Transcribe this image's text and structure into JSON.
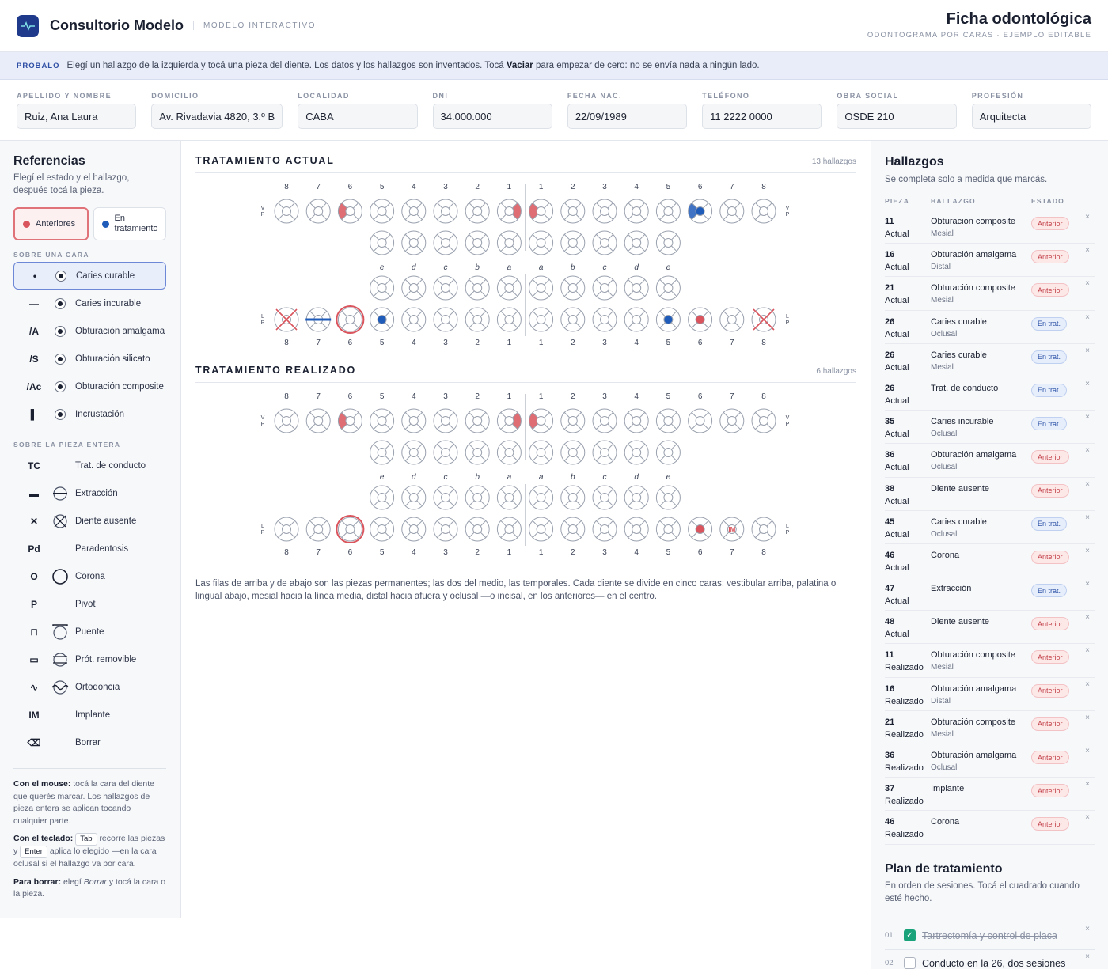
{
  "header": {
    "app_title": "Consultorio Modelo",
    "app_subtitle": "MODELO INTERACTIVO",
    "doc_title": "Ficha odontológica",
    "doc_subtitle": "ODONTOGRAMA POR CARAS · EJEMPLO EDITABLE"
  },
  "banner": {
    "tag": "PROBALO",
    "text_before": "Elegí un hallazgo de la izquierda y tocá una pieza del diente. Los datos y los hallazgos son inventados. Tocá",
    "bold": "Vaciar",
    "text_after": "para empezar de cero: no se envía nada a ningún lado."
  },
  "patient": [
    {
      "label": "APELLIDO Y NOMBRE",
      "value": "Ruiz, Ana Laura"
    },
    {
      "label": "DOMICILIO",
      "value": "Av. Rivadavia 4820, 3.º B"
    },
    {
      "label": "LOCALIDAD",
      "value": "CABA"
    },
    {
      "label": "DNI",
      "value": "34.000.000"
    },
    {
      "label": "FECHA NAC.",
      "value": "22/09/1989"
    },
    {
      "label": "TELÉFONO",
      "value": "11 2222 0000"
    },
    {
      "label": "OBRA SOCIAL",
      "value": "OSDE 210"
    },
    {
      "label": "PROFESIÓN",
      "value": "Arquitecta"
    }
  ],
  "refs": {
    "title": "Referencias",
    "hint": "Elegí el estado y el hallazgo, después tocá la pieza.",
    "state_anterior": "Anteriores",
    "state_trat": "En tratamiento",
    "colors": {
      "anterior": "#d9545c",
      "trat": "#1f5bb8"
    },
    "face_section": "SOBRE UNA CARA",
    "face_items": [
      {
        "code": "•",
        "label": "Caries curable",
        "icon": "face-dot-icon"
      },
      {
        "code": "—",
        "label": "Caries incurable",
        "icon": "face-dot-icon"
      },
      {
        "code": "/A",
        "label": "Obturación amalgama",
        "icon": "face-dot-icon"
      },
      {
        "code": "/S",
        "label": "Obturación silicato",
        "icon": "face-dot-icon"
      },
      {
        "code": "/Ac",
        "label": "Obturación composite",
        "icon": "face-dot-icon"
      },
      {
        "code": "▌",
        "label": "Incrustación",
        "icon": "face-dot-icon"
      }
    ],
    "whole_section": "SOBRE LA PIEZA ENTERA",
    "whole_items": [
      {
        "code": "TC",
        "label": "Trat. de conducto",
        "icon": ""
      },
      {
        "code": "▬",
        "label": "Extracción",
        "icon": "extraction-icon"
      },
      {
        "code": "✕",
        "label": "Diente ausente",
        "icon": "absent-icon"
      },
      {
        "code": "Pd",
        "label": "Paradentosis",
        "icon": ""
      },
      {
        "code": "O",
        "label": "Corona",
        "icon": "crown-icon"
      },
      {
        "code": "P",
        "label": "Pivot",
        "icon": ""
      },
      {
        "code": "⊓",
        "label": "Puente",
        "icon": "bridge-icon"
      },
      {
        "code": "▭",
        "label": "Prót. removible",
        "icon": "prosthesis-icon"
      },
      {
        "code": "∿",
        "label": "Ortodoncia",
        "icon": "ortho-icon"
      },
      {
        "code": "IM",
        "label": "Implante",
        "icon": ""
      },
      {
        "code": "⌫",
        "label": "Borrar",
        "icon": ""
      }
    ],
    "help_mouse_b": "Con el mouse:",
    "help_mouse": "tocá la cara del diente que querés marcar. Los hallazgos de pieza entera se aplican tocando cualquier parte.",
    "help_kbd_b": "Con el teclado:",
    "help_kbd_tab": "Tab",
    "help_kbd_1": "recorre las piezas y",
    "help_kbd_enter": "Enter",
    "help_kbd_2": "aplica lo elegido —en la cara oclusal si el hallazgo va por cara.",
    "help_del_b": "Para borrar:",
    "help_del_1": "elegí",
    "help_del_i": "Borrar",
    "help_del_2": "y tocá la cara o la pieza."
  },
  "odontograms": [
    {
      "title": "TRATAMIENTO ACTUAL",
      "count": "13 hallazgos",
      "marks": {
        "16": {
          "faces": {
            "d": "a"
          }
        },
        "11": {
          "faces": {
            "m": "a"
          }
        },
        "21": {
          "faces": {
            "m": "a"
          }
        },
        "26": {
          "faces": {
            "o": "t",
            "m": "t"
          },
          "tc": "t"
        },
        "35": {
          "faces": {
            "o": "t"
          }
        },
        "36": {
          "faces": {
            "o": "a"
          }
        },
        "38": {
          "whole": "absent",
          "st": "a"
        },
        "45": {
          "faces": {
            "o": "t"
          }
        },
        "46": {
          "whole": "crown",
          "st": "a"
        },
        "47": {
          "whole": "extraction",
          "st": "t"
        },
        "48": {
          "whole": "absent",
          "st": "a"
        }
      }
    },
    {
      "title": "TRATAMIENTO REALIZADO",
      "count": "6 hallazgos",
      "marks": {
        "16": {
          "faces": {
            "d": "a"
          }
        },
        "11": {
          "faces": {
            "m": "a"
          }
        },
        "21": {
          "faces": {
            "m": "a"
          }
        },
        "36": {
          "faces": {
            "o": "a"
          }
        },
        "37": {
          "whole": "implant",
          "st": "a"
        },
        "46": {
          "whole": "crown",
          "st": "a"
        }
      }
    }
  ],
  "odonto_labels": {
    "perm": [
      "8",
      "7",
      "6",
      "5",
      "4",
      "3",
      "2",
      "1",
      "1",
      "2",
      "3",
      "4",
      "5",
      "6",
      "7",
      "8"
    ],
    "temp": [
      "e",
      "d",
      "c",
      "b",
      "a",
      "a",
      "b",
      "c",
      "d",
      "e"
    ],
    "top_side": [
      "V",
      "P"
    ],
    "bottom_side": [
      "L",
      "P"
    ],
    "implant_text": "IM"
  },
  "note": "Las filas de arriba y de abajo son las piezas permanentes; las dos del medio, las temporales. Cada diente se divide en cinco caras: vestibular arriba, palatina o lingual abajo, mesial hacia la línea media, distal hacia afuera y oclusal —o incisal, en los anteriores— en el centro.",
  "findings": {
    "title": "Hallazgos",
    "hint": "Se completa solo a medida que marcás.",
    "col_piece": "PIEZA",
    "col_find": "HALLAZGO",
    "col_state": "ESTADO",
    "rows": [
      {
        "piece": "11",
        "kind": "Actual",
        "name": "Obturación composite",
        "face": "Mesial",
        "state": "Anterior",
        "cls": "a"
      },
      {
        "piece": "16",
        "kind": "Actual",
        "name": "Obturación amalgama",
        "face": "Distal",
        "state": "Anterior",
        "cls": "a"
      },
      {
        "piece": "21",
        "kind": "Actual",
        "name": "Obturación composite",
        "face": "Mesial",
        "state": "Anterior",
        "cls": "a"
      },
      {
        "piece": "26",
        "kind": "Actual",
        "name": "Caries curable",
        "face": "Oclusal",
        "state": "En trat.",
        "cls": "t"
      },
      {
        "piece": "26",
        "kind": "Actual",
        "name": "Caries curable",
        "face": "Mesial",
        "state": "En trat.",
        "cls": "t"
      },
      {
        "piece": "26",
        "kind": "Actual",
        "name": "Trat. de conducto",
        "face": "",
        "state": "En trat.",
        "cls": "t"
      },
      {
        "piece": "35",
        "kind": "Actual",
        "name": "Caries incurable",
        "face": "Oclusal",
        "state": "En trat.",
        "cls": "t"
      },
      {
        "piece": "36",
        "kind": "Actual",
        "name": "Obturación amalgama",
        "face": "Oclusal",
        "state": "Anterior",
        "cls": "a"
      },
      {
        "piece": "38",
        "kind": "Actual",
        "name": "Diente ausente",
        "face": "",
        "state": "Anterior",
        "cls": "a"
      },
      {
        "piece": "45",
        "kind": "Actual",
        "name": "Caries curable",
        "face": "Oclusal",
        "state": "En trat.",
        "cls": "t"
      },
      {
        "piece": "46",
        "kind": "Actual",
        "name": "Corona",
        "face": "",
        "state": "Anterior",
        "cls": "a"
      },
      {
        "piece": "47",
        "kind": "Actual",
        "name": "Extracción",
        "face": "",
        "state": "En trat.",
        "cls": "t"
      },
      {
        "piece": "48",
        "kind": "Actual",
        "name": "Diente ausente",
        "face": "",
        "state": "Anterior",
        "cls": "a"
      },
      {
        "piece": "11",
        "kind": "Realizado",
        "name": "Obturación composite",
        "face": "Mesial",
        "state": "Anterior",
        "cls": "a"
      },
      {
        "piece": "16",
        "kind": "Realizado",
        "name": "Obturación amalgama",
        "face": "Distal",
        "state": "Anterior",
        "cls": "a"
      },
      {
        "piece": "21",
        "kind": "Realizado",
        "name": "Obturación composite",
        "face": "Mesial",
        "state": "Anterior",
        "cls": "a"
      },
      {
        "piece": "36",
        "kind": "Realizado",
        "name": "Obturación amalgama",
        "face": "Oclusal",
        "state": "Anterior",
        "cls": "a"
      },
      {
        "piece": "37",
        "kind": "Realizado",
        "name": "Implante",
        "face": "",
        "state": "Anterior",
        "cls": "a"
      },
      {
        "piece": "46",
        "kind": "Realizado",
        "name": "Corona",
        "face": "",
        "state": "Anterior",
        "cls": "a"
      }
    ]
  },
  "plan": {
    "title": "Plan de tratamiento",
    "hint": "En orden de sesiones. Tocá el cuadrado cuando esté hecho.",
    "items": [
      {
        "num": "01",
        "text": "Tartrectomía y control de placa",
        "done": true
      },
      {
        "num": "02",
        "text": "Conducto en la 26, dos sesiones",
        "done": false
      }
    ]
  }
}
